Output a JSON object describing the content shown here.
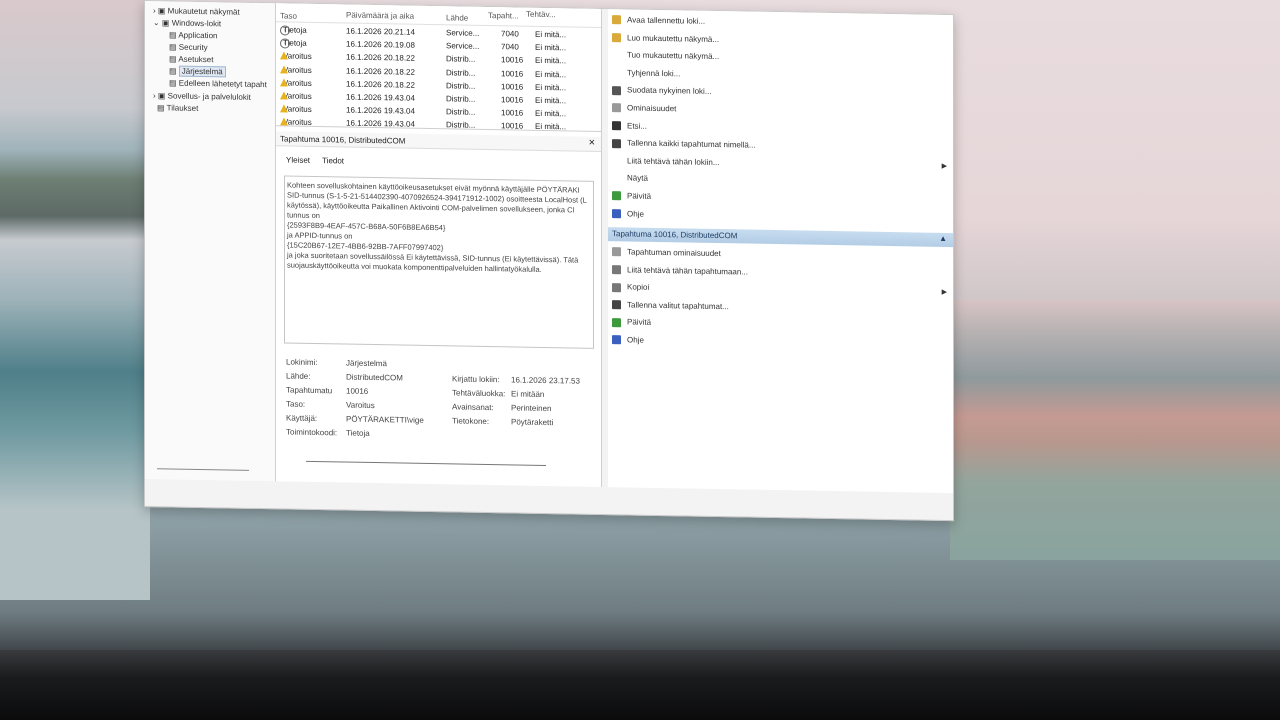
{
  "tree": {
    "items": [
      "Mukautetut näkymät",
      "Windows-lokit",
      "Application",
      "Security",
      "Asetukset",
      "Järjestelmä",
      "Edelleen lähetetyt tapaht",
      "Sovellus- ja palvelulokit",
      "Tilaukset"
    ]
  },
  "list": {
    "headers": {
      "level": "Taso",
      "date": "Päivämäärä ja aika",
      "source": "Lähde",
      "event": "Tapaht...",
      "task": "Tehtäv..."
    },
    "rows": [
      {
        "level": "Tietoja",
        "type": "info",
        "date": "16.1.2026 20.21.14",
        "source": "Service...",
        "event": "7040",
        "task": "Ei mitä..."
      },
      {
        "level": "Tietoja",
        "type": "info",
        "date": "16.1.2026 20.19.08",
        "source": "Service...",
        "event": "7040",
        "task": "Ei mitä..."
      },
      {
        "level": "Varoitus",
        "type": "warn",
        "date": "16.1.2026 20.18.22",
        "source": "Distrib...",
        "event": "10016",
        "task": "Ei mitä..."
      },
      {
        "level": "Varoitus",
        "type": "warn",
        "date": "16.1.2026 20.18.22",
        "source": "Distrib...",
        "event": "10016",
        "task": "Ei mitä..."
      },
      {
        "level": "Varoitus",
        "type": "warn",
        "date": "16.1.2026 20.18.22",
        "source": "Distrib...",
        "event": "10016",
        "task": "Ei mitä..."
      },
      {
        "level": "Varoitus",
        "type": "warn",
        "date": "16.1.2026 19.43.04",
        "source": "Distrib...",
        "event": "10016",
        "task": "Ei mitä..."
      },
      {
        "level": "Varoitus",
        "type": "warn",
        "date": "16.1.2026 19.43.04",
        "source": "Distrib...",
        "event": "10016",
        "task": "Ei mitä..."
      },
      {
        "level": "Varoitus",
        "type": "warn",
        "date": "16.1.2026 19.43.04",
        "source": "Distrib...",
        "event": "10016",
        "task": "Ei mitä..."
      }
    ]
  },
  "detail": {
    "title": "Tapahtuma 10016, DistributedCOM",
    "close": "×",
    "tabs": [
      "Yleiset",
      "Tiedot"
    ],
    "description": [
      "Kohteen sovelluskohtainen käyttöoikeusasetukset eivät myönnä käyttäjälle PÖYTÄRAKI",
      "SID-tunnus (S-1-5-21-514402390-4070926524-394171912-1002) osoitteesta LocalHost (L",
      "käytössä), käyttöoikeutta Paikallinen Aktivointi COM-palvelimen sovellukseen, jonka Cl",
      "tunnus on",
      "{2593F8B9-4EAF-457C-B68A-50F6B8EA6B54}",
      " ja APPID-tunnus on",
      "{15C20B67-12E7-4BB6-92BB-7AFF07997402}",
      " ja joka suoritetaan sovellussäilössä Ei käytettävissä, SID-tunnus (Ei käytettävissä). Tätä",
      "suojauskäyttöoikeutta voi muokata komponenttipalveluiden hallintatyökalulla."
    ],
    "props": {
      "log_label": "Lokinimi:",
      "log": "Järjestelmä",
      "source_label": "Lähde:",
      "source": "DistributedCOM",
      "logged_label": "Kirjattu lokiin:",
      "logged": "16.1.2026 23.17.53",
      "eventid_label": "Tapahtumatu",
      "eventid": "10016",
      "taskcat_label": "Tehtäväluokka:",
      "taskcat": "Ei mitään",
      "level_label": "Taso:",
      "level": "Varoitus",
      "keywords_label": "Avainsanat:",
      "keywords": "Perinteinen",
      "user_label": "Käyttäjä:",
      "user": "PÖYTÄRAKETTI\\vige",
      "computer_label": "Tietokone:",
      "computer": "Pöytäraketti",
      "opcode_label": "Toimintokoodi:",
      "opcode": "Tietoja"
    }
  },
  "actions": {
    "top": [
      {
        "label": "Avaa tallennettu loki...",
        "icon": "folder-icon",
        "color": "#d9a93a"
      },
      {
        "label": "Luo mukautettu näkymä...",
        "icon": "filter-icon",
        "color": "#d9a93a"
      },
      {
        "label": "Tuo mukautettu näkymä...",
        "icon": "none",
        "color": ""
      },
      {
        "label": "Tyhjennä loki...",
        "icon": "none",
        "color": ""
      },
      {
        "label": "Suodata nykyinen loki...",
        "icon": "funnel-icon",
        "color": "#555"
      },
      {
        "label": "Ominaisuudet",
        "icon": "properties-icon",
        "color": "#999"
      },
      {
        "label": "Etsi...",
        "icon": "binoculars-icon",
        "color": "#333"
      },
      {
        "label": "Tallenna kaikki tapahtumat nimellä...",
        "icon": "save-icon",
        "color": "#444"
      },
      {
        "label": "Liitä tehtävä tähän lokiin...",
        "icon": "none",
        "color": ""
      },
      {
        "label": "Näytä",
        "icon": "none",
        "color": ""
      },
      {
        "label": "Päivitä",
        "icon": "refresh-icon",
        "color": "#3c9a3c"
      },
      {
        "label": "Ohje",
        "icon": "help-icon",
        "color": "#3a5fbf"
      }
    ],
    "section_title": "Tapahtuma 10016, DistributedCOM",
    "section": [
      {
        "label": "Tapahtuman ominaisuudet",
        "icon": "properties-icon",
        "color": "#999"
      },
      {
        "label": "Liitä tehtävä tähän tapahtumaan...",
        "icon": "task-icon",
        "color": "#777"
      },
      {
        "label": "Kopioi",
        "icon": "copy-icon",
        "color": "#777"
      },
      {
        "label": "Tallenna valitut tapahtumat...",
        "icon": "save-icon",
        "color": "#444"
      },
      {
        "label": "Päivitä",
        "icon": "refresh-icon",
        "color": "#3c9a3c"
      },
      {
        "label": "Ohje",
        "icon": "help-icon",
        "color": "#3a5fbf"
      }
    ]
  }
}
